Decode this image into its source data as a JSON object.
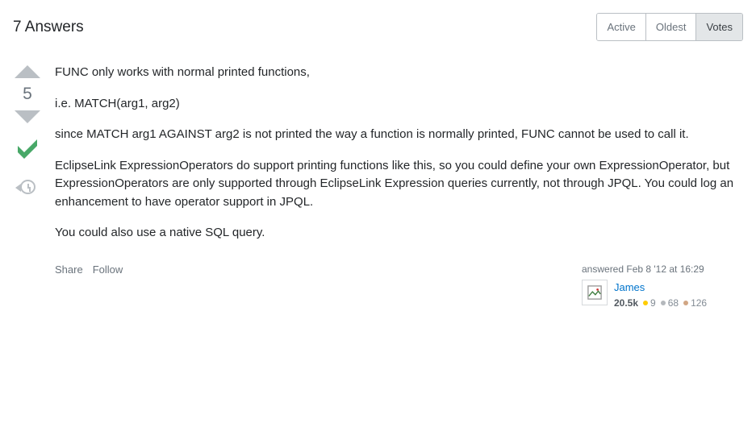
{
  "header": {
    "title": "7 Answers",
    "tabs": [
      "Active",
      "Oldest",
      "Votes"
    ],
    "active_tab": 2
  },
  "answer": {
    "vote_count": "5",
    "paragraphs": [
      "FUNC only works with normal printed functions,",
      "i.e. MATCH(arg1, arg2)",
      "since MATCH arg1 AGAINST arg2 is not printed the way a function is normally printed, FUNC cannot be used to call it.",
      "EclipseLink ExpressionOperators do support printing functions like this, so you could define your own ExpressionOperator, but ExpressionOperators are only supported through EclipseLink Expression queries currently, not through JPQL. You could log an enhancement to have operator support in JPQL.",
      "You could also use a native SQL query."
    ],
    "menu": {
      "share": "Share",
      "follow": "Follow"
    },
    "user_info": {
      "action_time": "answered Feb 8 '12 at 16:29",
      "name": "James",
      "reputation": "20.5k",
      "gold": "9",
      "silver": "68",
      "bronze": "126"
    }
  }
}
